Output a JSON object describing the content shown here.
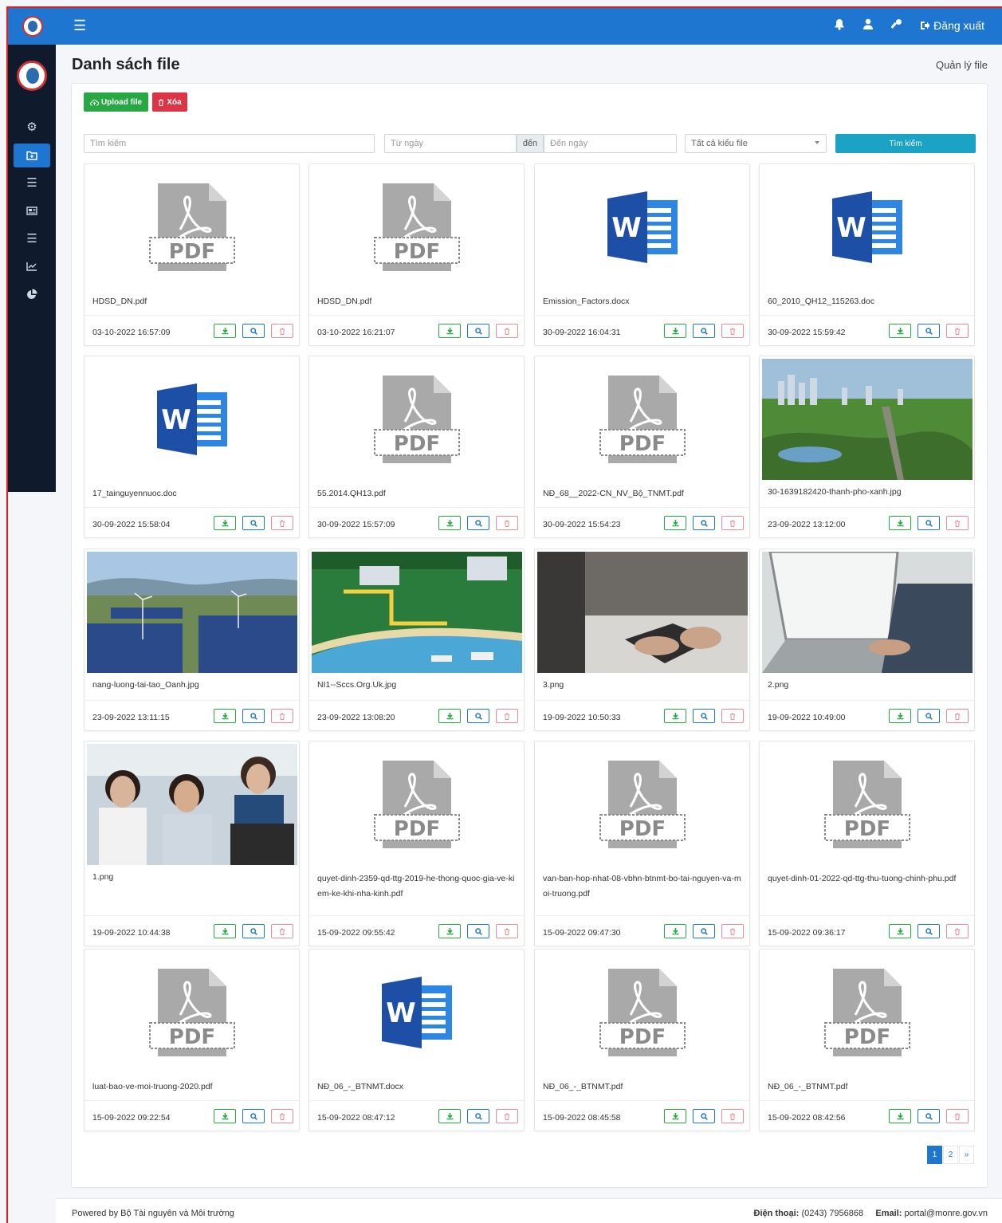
{
  "header": {
    "logout_label": "Đăng xuất",
    "menu_icon": "hamburger-icon",
    "icons": [
      "bell-icon",
      "user-icon",
      "key-icon",
      "logout-icon"
    ]
  },
  "sidebar": {
    "items": [
      {
        "name": "settings",
        "icon": "cogs-icon",
        "active": false
      },
      {
        "name": "files",
        "icon": "folder-icon",
        "active": true
      },
      {
        "name": "list",
        "icon": "list-icon",
        "active": false
      },
      {
        "name": "news",
        "icon": "newspaper-icon",
        "active": false
      },
      {
        "name": "list-2",
        "icon": "list-icon",
        "active": false
      },
      {
        "name": "chart",
        "icon": "line-chart-icon",
        "active": false
      },
      {
        "name": "pie",
        "icon": "pie-chart-icon",
        "active": false
      }
    ]
  },
  "page": {
    "title": "Danh sách file",
    "breadcrumb": "Quản lý file"
  },
  "toolbar": {
    "upload_label": "Upload file",
    "delete_label": "Xóa"
  },
  "filters": {
    "search_placeholder": "Tìm kiếm",
    "from_placeholder": "Từ ngày",
    "to_label": "đến",
    "to_placeholder": "Đến ngày",
    "type_value": "Tất cả kiểu file",
    "search_button": "Tìm kiếm"
  },
  "files": [
    {
      "name": "HDSD_DN.pdf",
      "date": "03-10-2022 16:57:09",
      "type": "pdf"
    },
    {
      "name": "HDSD_DN.pdf",
      "date": "03-10-2022 16:21:07",
      "type": "pdf"
    },
    {
      "name": "Emission_Factors.docx",
      "date": "30-09-2022 16:04:31",
      "type": "word"
    },
    {
      "name": "60_2010_QH12_115263.doc",
      "date": "30-09-2022 15:59:42",
      "type": "word"
    },
    {
      "name": "17_tainguyennuoc.doc",
      "date": "30-09-2022 15:58:04",
      "type": "word"
    },
    {
      "name": "55.2014.QH13.pdf",
      "date": "30-09-2022 15:57:09",
      "type": "pdf"
    },
    {
      "name": "NĐ_68__2022-CN_NV_Bộ_TNMT.pdf",
      "date": "30-09-2022 15:54:23",
      "type": "pdf"
    },
    {
      "name": "30-1639182420-thanh-pho-xanh.jpg",
      "date": "23-09-2022 13:12:00",
      "type": "photo",
      "scene": "city"
    },
    {
      "name": "nang-luong-tai-tao_Oanh.jpg",
      "date": "23-09-2022 13:11:15",
      "type": "photo",
      "scene": "solar"
    },
    {
      "name": "NI1--Sccs.Org.Uk.jpg",
      "date": "23-09-2022 13:08:20",
      "type": "photo",
      "scene": "infographic"
    },
    {
      "name": "3.png",
      "date": "19-09-2022 10:50:33",
      "type": "photo",
      "scene": "office"
    },
    {
      "name": "2.png",
      "date": "19-09-2022 10:49:00",
      "type": "photo",
      "scene": "laptop"
    },
    {
      "name": "1.png",
      "date": "19-09-2022 10:44:38",
      "type": "photo",
      "scene": "people"
    },
    {
      "name": "quyet-dinh-2359-qd-ttg-2019-he-thong-quoc-gia-ve-kiem-ke-khi-nha-kinh.pdf",
      "date": "15-09-2022 09:55:42",
      "type": "pdf"
    },
    {
      "name": "van-ban-hop-nhat-08-vbhn-btnmt-bo-tai-nguyen-va-moi-truong.pdf",
      "date": "15-09-2022 09:47:30",
      "type": "pdf"
    },
    {
      "name": "quyet-dinh-01-2022-qd-ttg-thu-tuong-chinh-phu.pdf",
      "date": "15-09-2022 09:36:17",
      "type": "pdf"
    },
    {
      "name": "luat-bao-ve-moi-truong-2020.pdf",
      "date": "15-09-2022 09:22:54",
      "type": "pdf"
    },
    {
      "name": "NĐ_06_-_BTNMT.docx",
      "date": "15-09-2022 08:47:12",
      "type": "word"
    },
    {
      "name": "NĐ_06_-_BTNMT.pdf",
      "date": "15-09-2022 08:45:58",
      "type": "pdf"
    },
    {
      "name": "NĐ_06_-_BTNMT.pdf",
      "date": "15-09-2022 08:42:56",
      "type": "pdf"
    }
  ],
  "pagination": {
    "pages": [
      "1",
      "2"
    ],
    "current": "1",
    "next": "»"
  },
  "footer": {
    "powered": "Powered by Bộ Tài nguyên và Môi trường",
    "phone_label": "Điện thoại:",
    "phone": "(0243) 7956868",
    "email_label": "Email:",
    "email": "portal@monre.gov.vn"
  },
  "colors": {
    "header": "#1f76d0",
    "sidebar": "#0f1b2d",
    "success": "#28a745",
    "danger": "#dc3545",
    "info": "#1ba3c6"
  }
}
